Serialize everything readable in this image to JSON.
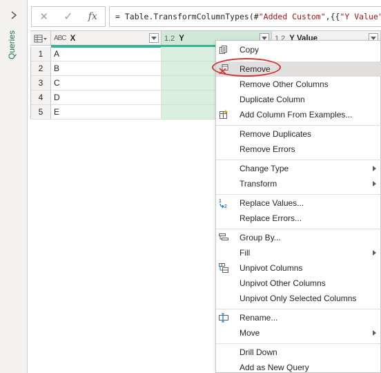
{
  "queries_pane": {
    "label": "Queries"
  },
  "formula_bar": {
    "cancel_glyph": "✕",
    "commit_glyph": "✓",
    "fx_label": "fx",
    "formula_prefix": "= Table.TransformColumnTypes(#",
    "formula_str1": "\"Added Custom\"",
    "formula_mid": ",{{",
    "formula_str2": "\"Y Value\"",
    "formula_tail": ", t"
  },
  "grid": {
    "columns": [
      {
        "name": "X",
        "type_label": "ABC"
      },
      {
        "name": "Y",
        "type_label": "1.2"
      },
      {
        "name": "Y Value",
        "type_label": "1.2"
      }
    ],
    "rows": [
      {
        "num": "1",
        "x": "A"
      },
      {
        "num": "2",
        "x": "B"
      },
      {
        "num": "3",
        "x": "C"
      },
      {
        "num": "4",
        "x": "D"
      },
      {
        "num": "5",
        "x": "E"
      }
    ]
  },
  "context_menu": {
    "items": [
      {
        "label": "Copy",
        "icon": "copy-icon"
      },
      {
        "label": "Remove",
        "icon": "remove-icon"
      },
      {
        "label": "Remove Other Columns"
      },
      {
        "label": "Duplicate Column"
      },
      {
        "label": "Add Column From Examples...",
        "icon": "add-column-from-examples-icon"
      },
      {
        "label": "Remove Duplicates"
      },
      {
        "label": "Remove Errors"
      },
      {
        "label": "Change Type",
        "submenu": true
      },
      {
        "label": "Transform",
        "submenu": true
      },
      {
        "label": "Replace Values...",
        "icon": "replace-values-icon"
      },
      {
        "label": "Replace Errors..."
      },
      {
        "label": "Group By...",
        "icon": "group-by-icon"
      },
      {
        "label": "Fill",
        "submenu": true
      },
      {
        "label": "Unpivot Columns",
        "icon": "unpivot-icon"
      },
      {
        "label": "Unpivot Other Columns"
      },
      {
        "label": "Unpivot Only Selected Columns"
      },
      {
        "label": "Rename...",
        "icon": "rename-icon"
      },
      {
        "label": "Move",
        "submenu": true
      },
      {
        "label": "Drill Down"
      },
      {
        "label": "Add as New Query"
      }
    ]
  },
  "colors": {
    "accent_green": "#217346",
    "quality_bar": "#35b392",
    "selected_column": "#d9f0e1",
    "highlight_ellipse": "#d13438"
  }
}
